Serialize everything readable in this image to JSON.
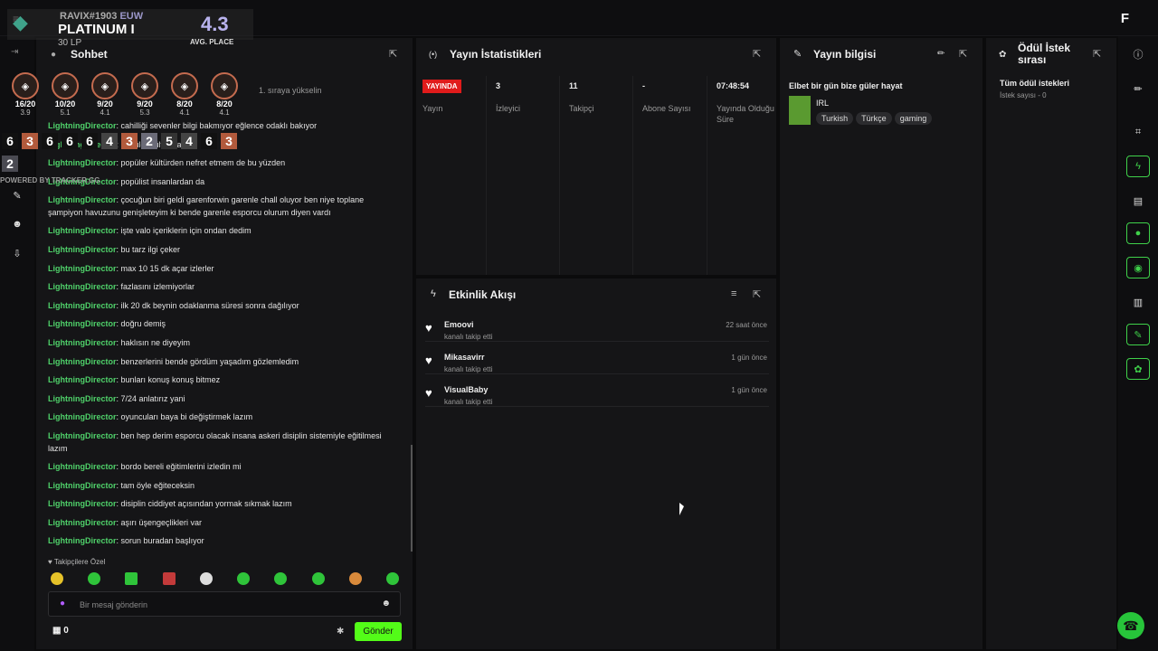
{
  "overlay": {
    "tag": "RAVIX#1903",
    "region": "EUW",
    "rank": "PLATINUM I",
    "lp": "30 LP",
    "avg_value": "4.3",
    "avg_label": "AVG. PLACE",
    "powered": "POWERED BY TRACKER.GG",
    "badges": [
      {
        "score": "16/20",
        "sub": "3.9"
      },
      {
        "score": "10/20",
        "sub": "5.1"
      },
      {
        "score": "9/20",
        "sub": "4.1"
      },
      {
        "score": "9/20",
        "sub": "5.3"
      },
      {
        "score": "8/20",
        "sub": "4.1"
      },
      {
        "score": "8/20",
        "sub": "4.1"
      }
    ],
    "digits": [
      "6",
      "3",
      "6",
      "6",
      "6",
      "4",
      "3",
      "2",
      "5",
      "4",
      "6",
      "3"
    ],
    "digit2": "2"
  },
  "chat": {
    "title": "Sohbet",
    "pinned_note": "1. sıraya yükselin",
    "messages": [
      {
        "user": "LightningDirector",
        "text": "cahilliği sevenler bilgi bakmıyor eğlence odaklı bakıyor"
      },
      {
        "user": "LightningDirector",
        "text": "popüler kültürü alıyor"
      },
      {
        "user": "LightningDirector",
        "text": "popüler kültürden nefret etmem de bu yüzden"
      },
      {
        "user": "LightningDirector",
        "text": "popülist insanlardan da"
      },
      {
        "user": "LightningDirector",
        "text": "çocuğun biri geldi garenforwin garenle chall oluyor ben niye toplane şampiyon havuzunu genişleteyim ki bende garenle esporcu olurum diyen vardı"
      },
      {
        "user": "LightningDirector",
        "text": "işte valo içeriklerin için ondan dedim"
      },
      {
        "user": "LightningDirector",
        "text": "bu tarz ilgi çeker"
      },
      {
        "user": "LightningDirector",
        "text": "max 10 15 dk açar izlerler"
      },
      {
        "user": "LightningDirector",
        "text": "fazlasını izlemiyorlar"
      },
      {
        "user": "LightningDirector",
        "text": "ilk 20 dk beynin odaklanma süresi sonra dağılıyor"
      },
      {
        "user": "LightningDirector",
        "text": "doğru demiş"
      },
      {
        "user": "LightningDirector",
        "text": "haklısın ne diyeyim"
      },
      {
        "user": "LightningDirector",
        "text": "benzerlerini bende gördüm yaşadım gözlemledim"
      },
      {
        "user": "LightningDirector",
        "text": "bunları konuş konuş bitmez"
      },
      {
        "user": "LightningDirector",
        "text": "7/24 anlatırız yani"
      },
      {
        "user": "LightningDirector",
        "text": "oyuncuları baya bi değiştirmek lazım"
      },
      {
        "user": "LightningDirector",
        "text": "ben hep derim esporcu olacak insana askeri disiplin sistemiyle eğitilmesi lazım"
      },
      {
        "user": "LightningDirector",
        "text": "bordo bereli eğitimlerini izledin mi"
      },
      {
        "user": "LightningDirector",
        "text": "tam öyle eğiteceksin"
      },
      {
        "user": "LightningDirector",
        "text": "disiplin ciddiyet açısından yormak sıkmak lazım"
      },
      {
        "user": "LightningDirector",
        "text": "aşırı üşengeçlikleri var"
      },
      {
        "user": "LightningDirector",
        "text": "sorun buradan başlıyor"
      }
    ],
    "followers_only": "Takipçilere Özel",
    "input_placeholder": "Bir mesaj gönderin",
    "points": "0",
    "send_label": "Gönder"
  },
  "stats": {
    "title": "Yayın İstatistikleri",
    "live_badge": "YAYINDA",
    "live_label": "Yayın",
    "cols": [
      {
        "value": "3",
        "label": "İzleyici"
      },
      {
        "value": "11",
        "label": "Takipçi"
      },
      {
        "value": "-",
        "label": "Abone Sayısı"
      },
      {
        "value": "07:48:54",
        "label": "Yayında Olduğu Süre"
      }
    ]
  },
  "streaminfo": {
    "title": "Yayın bilgisi",
    "stream_title": "Elbet bir gün bize güler hayat",
    "category": "IRL",
    "tags": [
      "Turkish",
      "Türkçe",
      "gaming"
    ]
  },
  "rewards": {
    "title": "Ödül İstek sırası",
    "all_label": "Tüm ödül istekleri",
    "count_label": "İstek sayısı - 0"
  },
  "activity": {
    "title": "Etkinlik Akışı",
    "items": [
      {
        "name": "Emoovi",
        "action": "kanalı takip etti",
        "time": "22 saat önce"
      },
      {
        "name": "Mikasavirr",
        "action": "kanalı takip etti",
        "time": "1 gün önce"
      },
      {
        "name": "VisualBaby",
        "action": "kanalı takip etti",
        "time": "1 gün önce"
      }
    ]
  },
  "colors": {
    "accent": "#53fc18",
    "live": "#e01b1b",
    "username": "#4fd16a"
  }
}
